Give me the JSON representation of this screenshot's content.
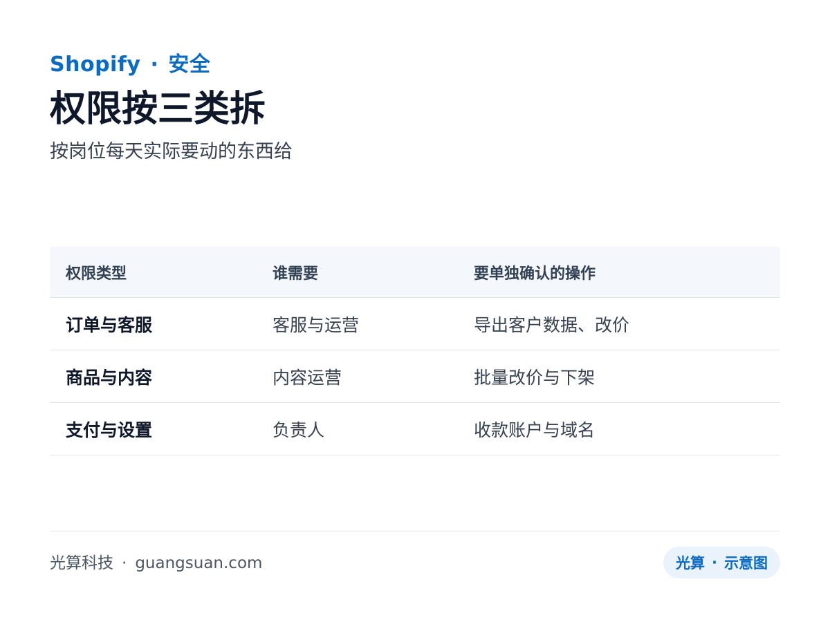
{
  "header": {
    "brand": "Shopify",
    "separator": "·",
    "category": "安全",
    "title": "权限按三类拆",
    "subtitle": "按岗位每天实际要动的东西给"
  },
  "table": {
    "columns": [
      "权限类型",
      "谁需要",
      "要单独确认的操作"
    ],
    "rows": [
      [
        "订单与客服",
        "客服与运营",
        "导出客户数据、改价"
      ],
      [
        "商品与内容",
        "内容运营",
        "批量改价与下架"
      ],
      [
        "支付与设置",
        "负责人",
        "收款账户与域名"
      ]
    ]
  },
  "footer": {
    "company": "光算科技",
    "separator": "·",
    "domain": "guangsuan.com",
    "badge_left": "光算",
    "badge_separator": "·",
    "badge_right": "示意图"
  },
  "colors": {
    "accent": "#0a6bc4",
    "title": "#0f172a",
    "header_bg": "#f4f7fc",
    "badge_bg": "#eaf2fc",
    "divider": "#e2e5ea"
  }
}
